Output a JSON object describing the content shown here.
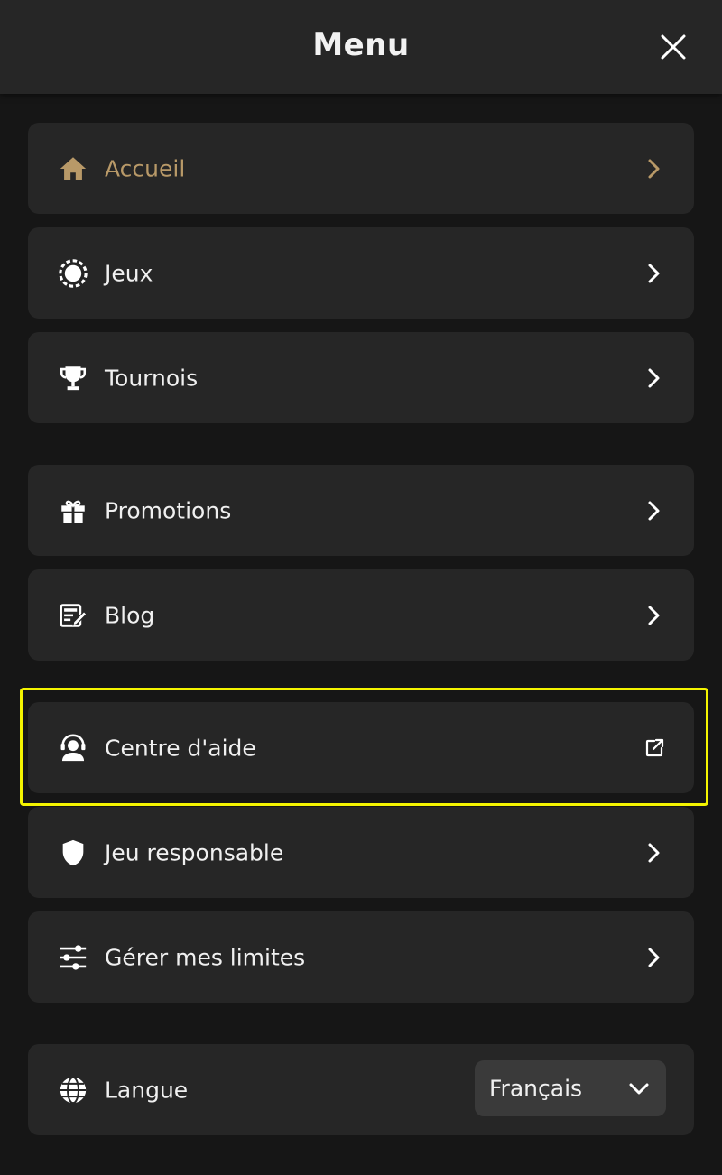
{
  "header": {
    "title": "Menu"
  },
  "colors": {
    "accent": "#b89968",
    "highlight": "#f4f400"
  },
  "menu": {
    "items": [
      {
        "label": "Accueil",
        "icon": "home-icon",
        "trailing": "chevron-right-icon",
        "active": true
      },
      {
        "label": "Jeux",
        "icon": "casino-chip-icon",
        "trailing": "chevron-right-icon"
      },
      {
        "label": "Tournois",
        "icon": "trophy-icon",
        "trailing": "chevron-right-icon"
      },
      {
        "label": "Promotions",
        "icon": "gift-icon",
        "trailing": "chevron-right-icon"
      },
      {
        "label": "Blog",
        "icon": "blog-edit-icon",
        "trailing": "chevron-right-icon"
      },
      {
        "label": "Centre d'aide",
        "icon": "support-agent-icon",
        "trailing": "external-link-icon",
        "highlighted": true
      },
      {
        "label": "Jeu responsable",
        "icon": "shield-icon",
        "trailing": "chevron-right-icon"
      },
      {
        "label": "Gérer mes limites",
        "icon": "sliders-icon",
        "trailing": "chevron-right-icon"
      }
    ]
  },
  "language": {
    "label": "Langue",
    "icon": "globe-icon",
    "selected": "Français"
  }
}
